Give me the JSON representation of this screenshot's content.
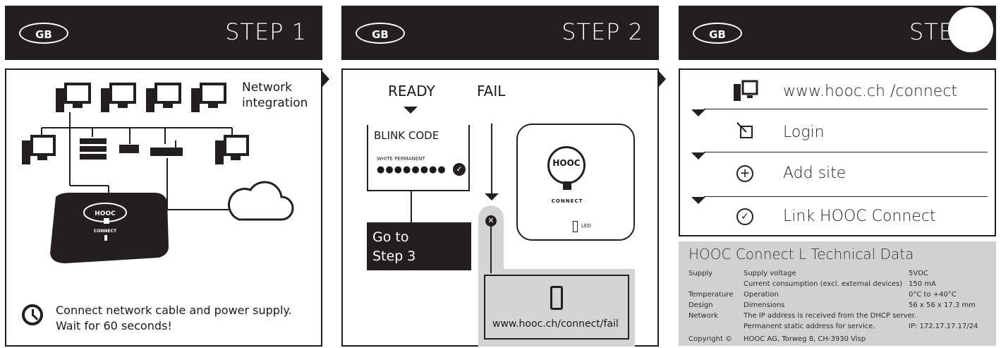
{
  "panels": [
    {
      "badge": "GB",
      "step": "STEP 1"
    },
    {
      "badge": "GB",
      "step": "STEP 2"
    },
    {
      "badge": "GB",
      "step": "STE"
    }
  ],
  "step1": {
    "network_label_1": "Network",
    "network_label_2": "integration",
    "device_brand": "HOOC",
    "device_sub": "CONNECT",
    "instruction_1": "Connect network cable and power supply.",
    "instruction_2": "Wait for 60 seconds!"
  },
  "step2": {
    "ready": "READY",
    "fail": "FAIL",
    "blink_code": "BLINK CODE",
    "white_permanent": "WHITE PERMANENT",
    "goto_1": "Go to",
    "goto_2": "Step 3",
    "device_brand": "HOOC",
    "device_sub": "CONNECT",
    "led": "LED",
    "fail_url": "www.hooc.ch/connect/fail"
  },
  "step3": {
    "rows": [
      {
        "icon": "computer-icon",
        "label": "www.hooc.ch /connect"
      },
      {
        "icon": "login-icon",
        "label": "Login"
      },
      {
        "icon": "plus-circle-icon",
        "label": "Add site"
      },
      {
        "icon": "check-circle-icon",
        "label": "Link HOOC Connect"
      }
    ]
  },
  "tech": {
    "title": "HOOC Connect L Technical Data",
    "rows": [
      {
        "k": "Supply",
        "d": "Supply voltage",
        "v": "5VDC"
      },
      {
        "k": "",
        "d": "Current consumption (excl. external devices)",
        "v": "150 mA"
      },
      {
        "k": "Temperature",
        "d": "Operation",
        "v": "0°C to +40°C"
      },
      {
        "k": "Design",
        "d": "Dimensions",
        "v": "56 x 56 x 17.3 mm"
      },
      {
        "k": "Network",
        "d": "The IP address is received from the DHCP server.",
        "v": ""
      },
      {
        "k": "",
        "d": "Permanent static address for service.",
        "v": "IP: 172.17.17.17/24"
      },
      {
        "k": "Copyright ©",
        "d": "HOOC AG, Torweg 8, CH-3930 Visp",
        "v": ""
      }
    ]
  }
}
